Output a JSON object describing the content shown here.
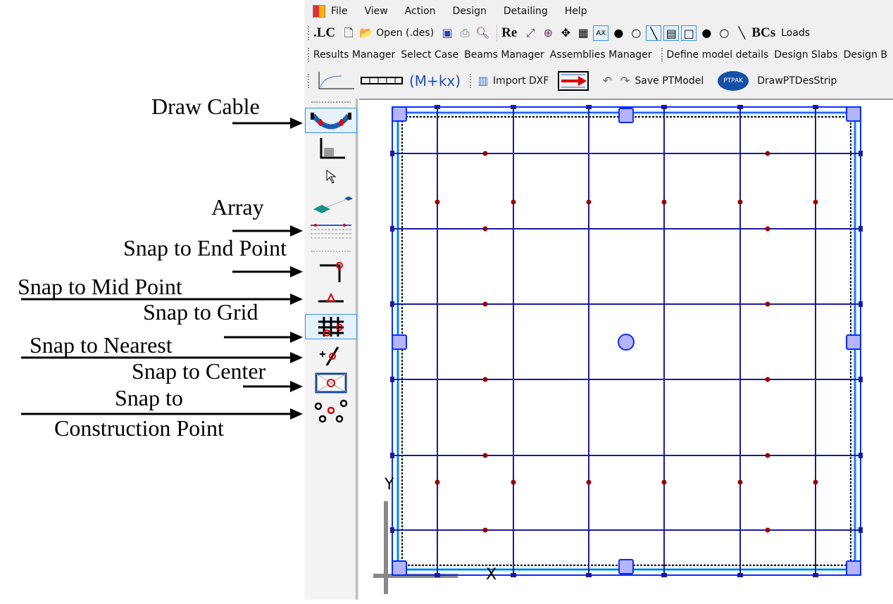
{
  "menu": {
    "items": [
      "File",
      "View",
      "Action",
      "Design",
      "Detailing",
      "Help"
    ]
  },
  "toolbar1": {
    "lc": ".LC",
    "open": "Open (.des)",
    "re": "Re",
    "bcs": "BCs",
    "loads": "Loads"
  },
  "toolbar2": {
    "items": [
      "Results Manager",
      "Select Case",
      "Beams Manager",
      "Assemblies Manager",
      "Define model details",
      "Design Slabs",
      "Design B"
    ]
  },
  "toolbar3": {
    "mkx": "(M+kx)",
    "import_dxf": "Import DXF",
    "save": "Save PTModel",
    "ptpak": "PTPAK",
    "draw": "DrawPTDesStrip"
  },
  "canvas": {
    "x_axis": "X",
    "y_axis": "Y"
  },
  "annotations": [
    "Draw Cable",
    "Array",
    "Snap to End Point",
    "Snap to Mid Point",
    "Snap to Grid",
    "Snap to Nearest",
    "Snap to Center",
    "Snap to",
    "Construction Point"
  ],
  "colors": {
    "grid": "#1a1aa0",
    "frame": "#0a2cff",
    "point": "#9b0000",
    "beam_fill": "#8ee8ff"
  }
}
